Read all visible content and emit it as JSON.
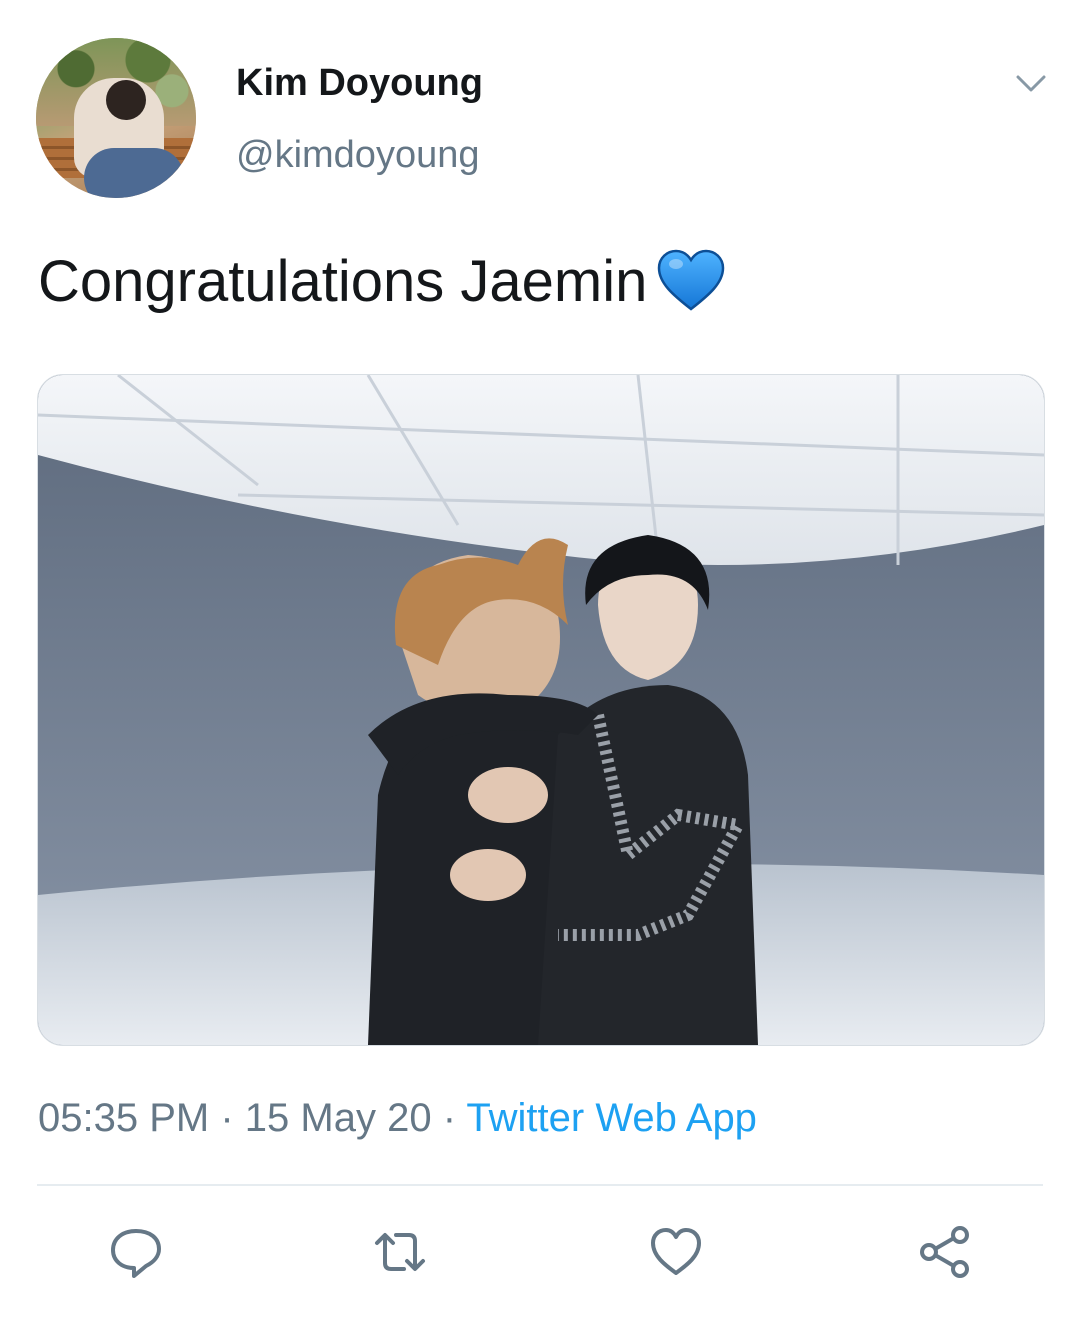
{
  "tweet": {
    "author_name": "Kim Doyoung",
    "author_handle": "@kimdoyoung",
    "text": "Congratulations Jaemin",
    "emoji": "blue-heart-emoji",
    "time": "05:35 PM",
    "separator": "·",
    "date": "15 May 20",
    "source": "Twitter Web App"
  },
  "icons": {
    "menu": "chevron-down-icon",
    "reply": "reply-icon",
    "retweet": "retweet-icon",
    "like": "like-icon",
    "share": "share-icon"
  },
  "colors": {
    "text_primary": "#14171a",
    "text_secondary": "#657786",
    "link": "#1da1f2",
    "heart_emoji": "#2196f3"
  }
}
